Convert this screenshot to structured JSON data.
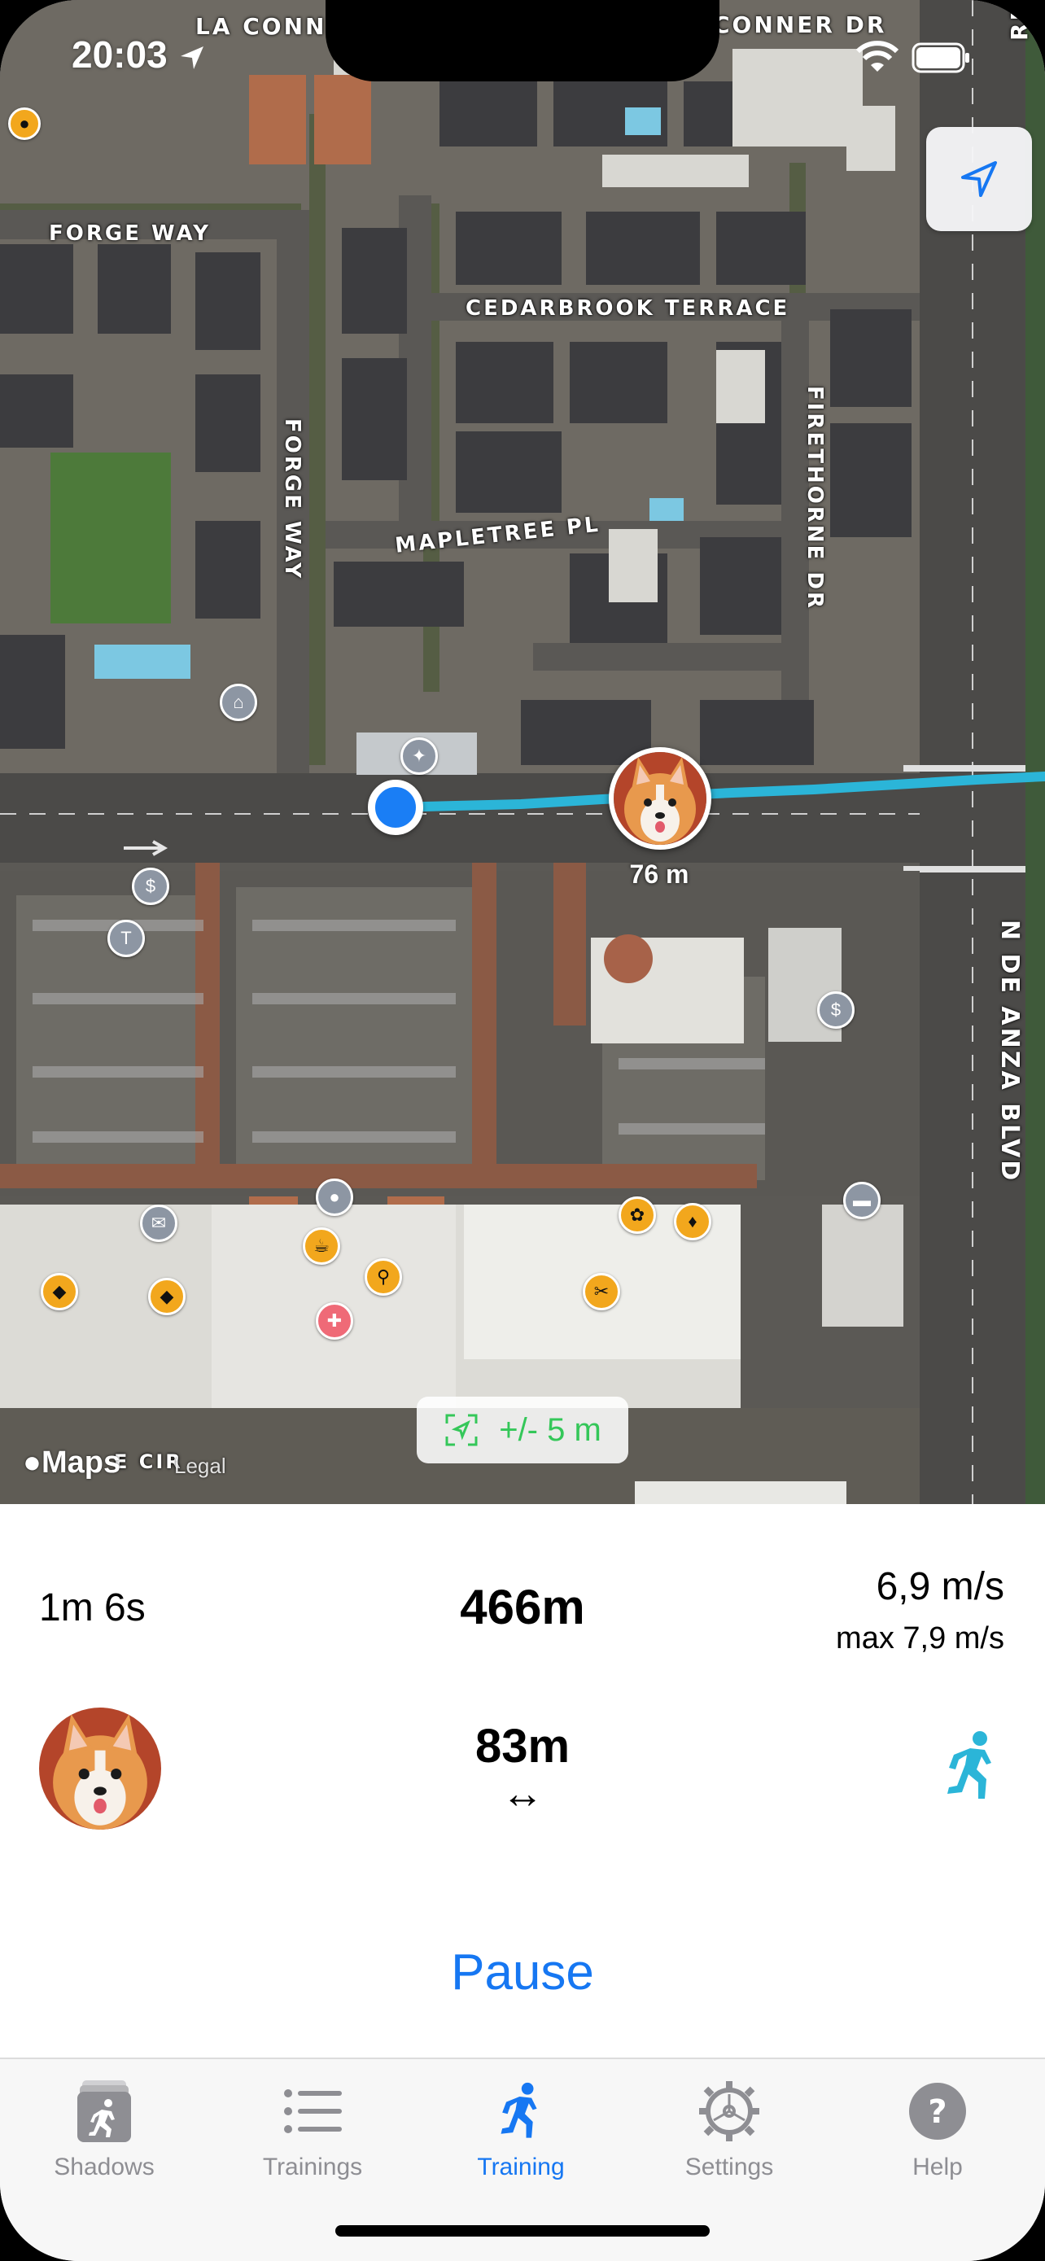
{
  "status_bar": {
    "time": "20:03"
  },
  "map": {
    "street_labels": {
      "la_conner_top": "LA CONNE",
      "conner_dr_top": "CONNER DR",
      "rd_edge": "RD",
      "forge_way_h": "FORGE WAY",
      "forge_way_v": "FORGE WAY",
      "cedarbrook": "CEDARBROOK TERRACE",
      "mapletree": "MAPLETREE PL",
      "firethorne": "FIRETHORNE DR",
      "de_anza": "N DE ANZA BLVD",
      "bottom_cir": "E CIR"
    },
    "dog_distance": "76 m",
    "accuracy": "+/- 5 m",
    "attribution": "Maps",
    "legal": "Legal",
    "colors": {
      "route": "#2bb5d8",
      "user_dot": "#1a7ef5",
      "accuracy": "#34c759"
    }
  },
  "stats": {
    "elapsed": "1m 6s",
    "total_distance": "466m",
    "speed": "6,9 m/s",
    "max_speed": "max 7,9 m/s",
    "gap_distance": "83m",
    "gap_symbol": "↔",
    "pause_label": "Pause",
    "accent": "#1677f2",
    "runner_color": "#2bb5d8"
  },
  "tabs": [
    {
      "label": "Shadows",
      "icon": "shadows-icon",
      "active": false
    },
    {
      "label": "Trainings",
      "icon": "list-icon",
      "active": false
    },
    {
      "label": "Training",
      "icon": "runner-icon",
      "active": true
    },
    {
      "label": "Settings",
      "icon": "gear-icon",
      "active": false
    },
    {
      "label": "Help",
      "icon": "question-icon",
      "active": false
    }
  ]
}
